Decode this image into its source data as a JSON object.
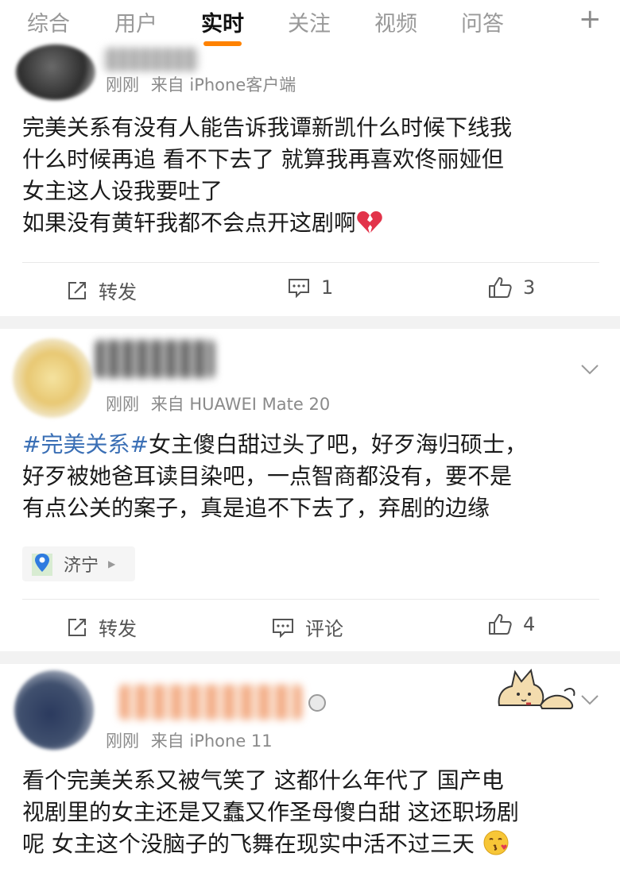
{
  "tabs": [
    "综合",
    "用户",
    "实时",
    "关注",
    "视频",
    "问答"
  ],
  "tabs_plus": "+",
  "posts": [
    {
      "meta_time": "刚刚",
      "meta_source": "来自 iPhone客户端",
      "content_lines": [
        "完美关系有没有人能告诉我谭新凯什么时候下线我",
        "什么时候再追 看不下去了 就算我再喜欢佟丽娅但",
        "女主这人设我要吐了",
        "如果没有黄轩我都不会点开这剧啊"
      ],
      "repost_label": "转发",
      "comment_label": "1",
      "like_count": "3"
    },
    {
      "meta_time": "刚刚",
      "meta_source": "来自 HUAWEI Mate 20",
      "topic": "#完美关系#",
      "content_first": "女主傻白甜过头了吧，好歹海归硕士，",
      "content_lines": [
        "好歹被她爸耳读目染吧，一点智商都没有，要不是",
        "有点公关的案子，真是追不下去了，弃剧的边缘"
      ],
      "location": "济宁",
      "repost_label": "转发",
      "comment_label": "评论",
      "like_count": "4"
    },
    {
      "meta_time": "刚刚",
      "meta_source": "来自 iPhone 11",
      "content_lines": [
        "看个完美关系又被气笑了 这都什么年代了 国产电",
        "视剧里的女主还是又蠢又作圣母傻白甜 这还职场剧",
        "呢 女主这个没脑子的飞舞在现实中活不过三天"
      ]
    }
  ]
}
